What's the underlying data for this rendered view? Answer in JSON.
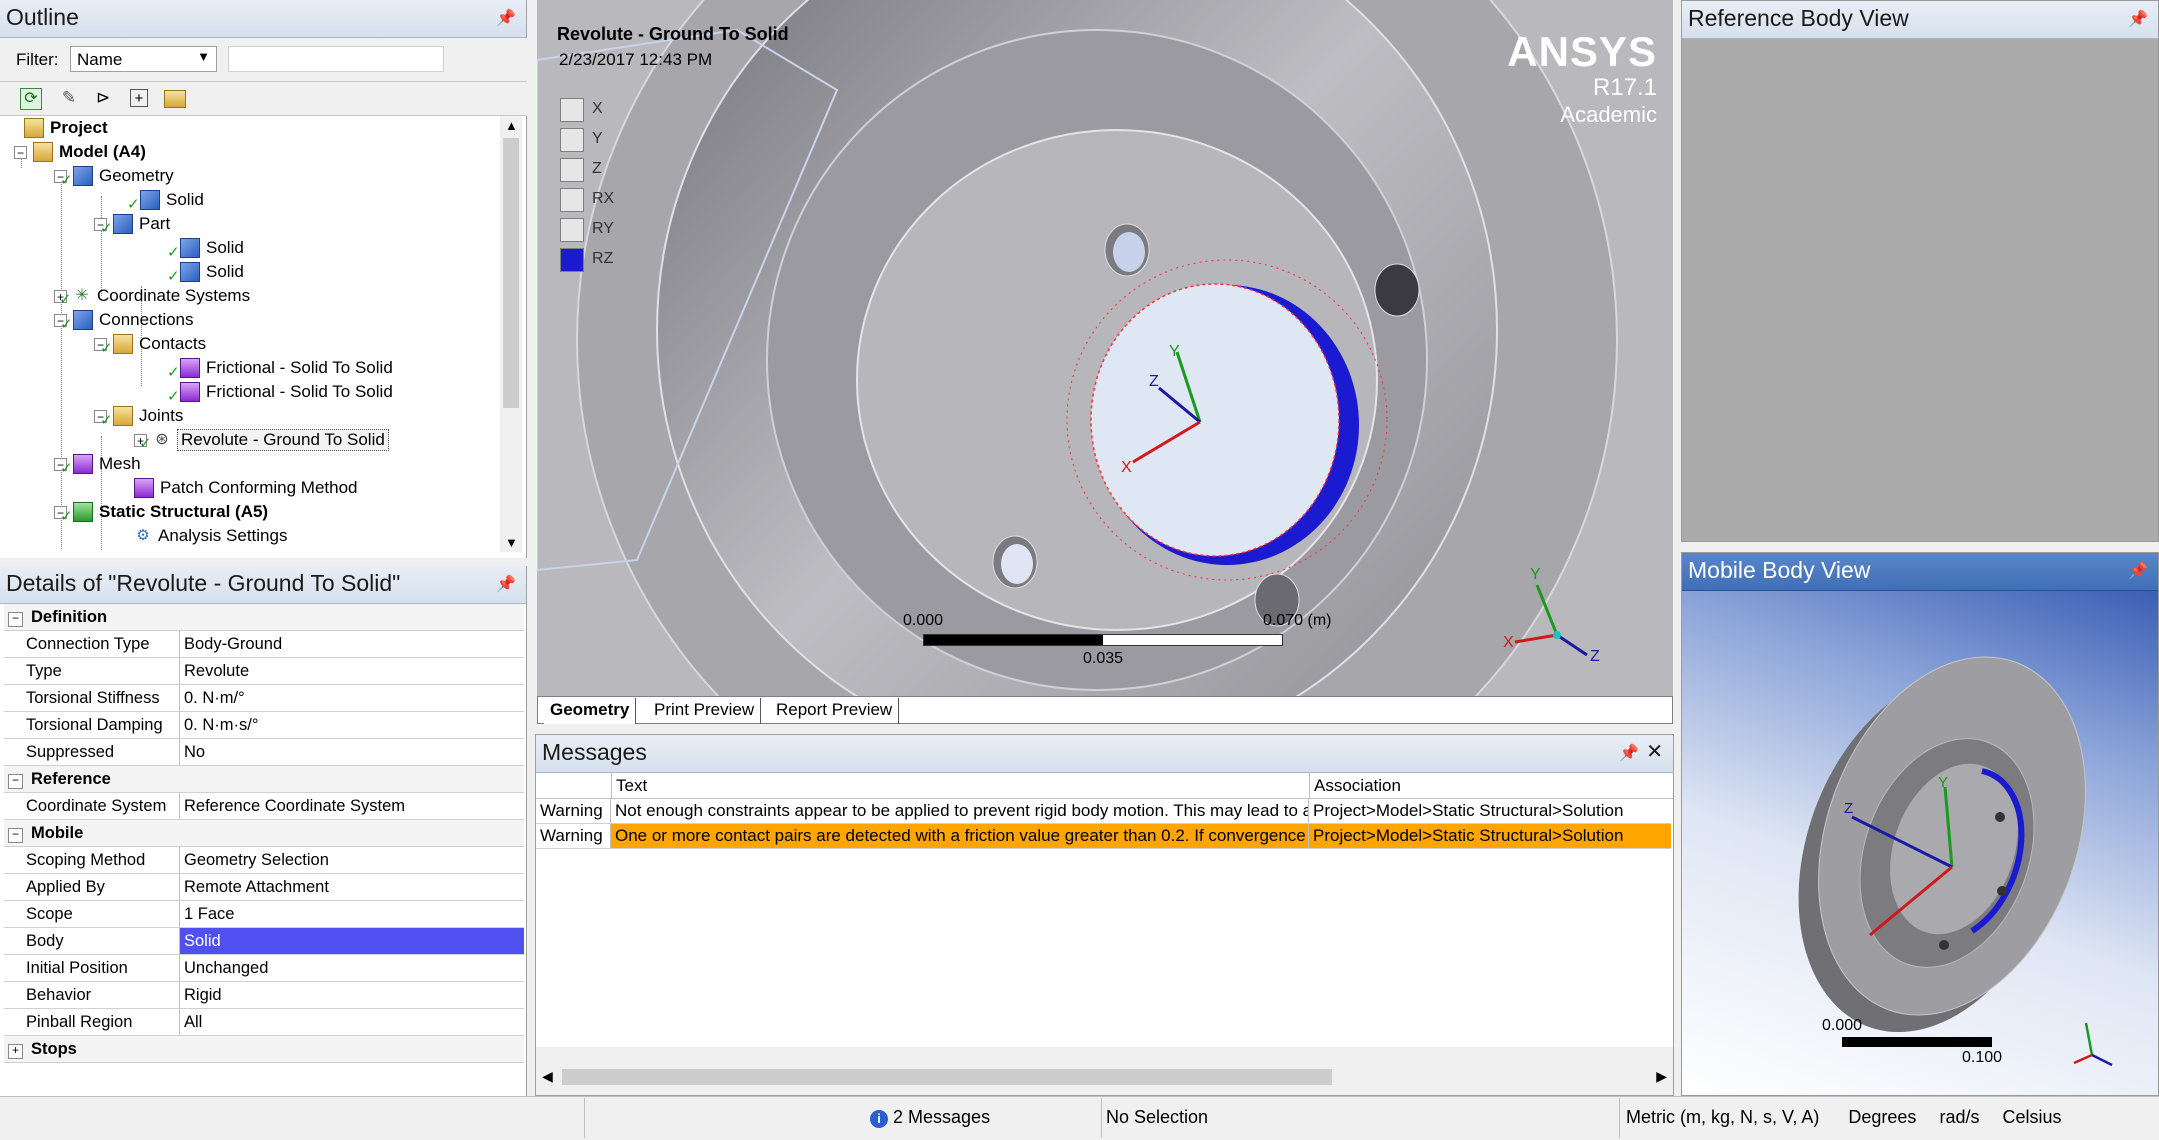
{
  "outline": {
    "title": "Outline",
    "filter_label": "Filter:",
    "filter_value": "Name",
    "tree": [
      {
        "label": "Project",
        "bold": true
      },
      {
        "label": "Model (A4)",
        "bold": true
      },
      {
        "label": "Geometry"
      },
      {
        "label": "Solid"
      },
      {
        "label": "Part"
      },
      {
        "label": "Solid"
      },
      {
        "label": "Solid"
      },
      {
        "label": "Coordinate Systems"
      },
      {
        "label": "Connections"
      },
      {
        "label": "Contacts"
      },
      {
        "label": "Frictional - Solid To Solid"
      },
      {
        "label": "Frictional - Solid To Solid"
      },
      {
        "label": "Joints"
      },
      {
        "label": "Revolute - Ground To Solid",
        "selected": true
      },
      {
        "label": "Mesh"
      },
      {
        "label": "Patch Conforming Method"
      },
      {
        "label": "Static Structural (A5)",
        "bold": true
      },
      {
        "label": "Analysis Settings"
      }
    ]
  },
  "details": {
    "title": "Details of \"Revolute - Ground To Solid\"",
    "rows": [
      {
        "section": "Definition"
      },
      {
        "key": "Connection Type",
        "value": "Body-Ground"
      },
      {
        "key": "Type",
        "value": "Revolute"
      },
      {
        "key": "Torsional Stiffness",
        "value": "0. N·m/°"
      },
      {
        "key": "Torsional Damping",
        "value": "0. N·m·s/°"
      },
      {
        "key": "Suppressed",
        "value": "No"
      },
      {
        "section": "Reference"
      },
      {
        "key": "Coordinate System",
        "value": "Reference Coordinate System"
      },
      {
        "section": "Mobile"
      },
      {
        "key": "Scoping Method",
        "value": "Geometry Selection"
      },
      {
        "key": "Applied By",
        "value": "Remote Attachment"
      },
      {
        "key": "Scope",
        "value": "1 Face"
      },
      {
        "key": "Body",
        "value": "Solid",
        "highlight": true
      },
      {
        "key": "Initial Position",
        "value": "Unchanged"
      },
      {
        "key": "Behavior",
        "value": "Rigid"
      },
      {
        "key": "Pinball Region",
        "value": "All"
      },
      {
        "section": "Stops",
        "collapsed": true
      }
    ]
  },
  "viewport": {
    "title": "Revolute - Ground To Solid",
    "timestamp": "2/23/2017 12:43 PM",
    "brand": "ANSYS",
    "version": "R17.1",
    "edition": "Academic",
    "dofs": [
      {
        "label": "X",
        "checked": false
      },
      {
        "label": "Y",
        "checked": false
      },
      {
        "label": "Z",
        "checked": false
      },
      {
        "label": "RX",
        "checked": false
      },
      {
        "label": "RY",
        "checked": false
      },
      {
        "label": "RZ",
        "checked": true
      }
    ],
    "scale": {
      "left": "0.000",
      "right": "0.070 (m)",
      "mid": "0.035"
    },
    "triad": {
      "x": "X",
      "y": "Y",
      "z": "Z"
    },
    "tabs": [
      "Geometry",
      "Print Preview",
      "Report Preview"
    ]
  },
  "messages": {
    "title": "Messages",
    "columns": [
      "Text",
      "Association"
    ],
    "rows": [
      {
        "type": "Warning",
        "text": "Not enough constraints appear to be applied to prevent rigid body motion.  This may lead to a solver pivot warning or error.",
        "association": "Project>Model>Static Structural>Solution",
        "highlight": false
      },
      {
        "type": "Warning",
        "text": " One or more contact pairs are detected with a friction value greater than 0.2. If convergence difficulties are encountered, consider the unsymmetric option.",
        "association": "Project>Model>Static Structural>Solution",
        "highlight": true
      }
    ]
  },
  "reference_view": {
    "title": "Reference Body View"
  },
  "mobile_view": {
    "title": "Mobile Body View",
    "scale_left": "0.000",
    "scale_right": "0.100"
  },
  "statusbar": {
    "messages": "2 Messages",
    "selection": "No Selection",
    "units": "Metric (m, kg, N, s, V, A)",
    "angle": "Degrees",
    "angular_velocity": "rad/s",
    "temperature": "Celsius"
  },
  "colors": {
    "highlight_blue": "#5050f0",
    "warning_orange": "#ffa500",
    "selection_face": "#1a1ad0"
  }
}
